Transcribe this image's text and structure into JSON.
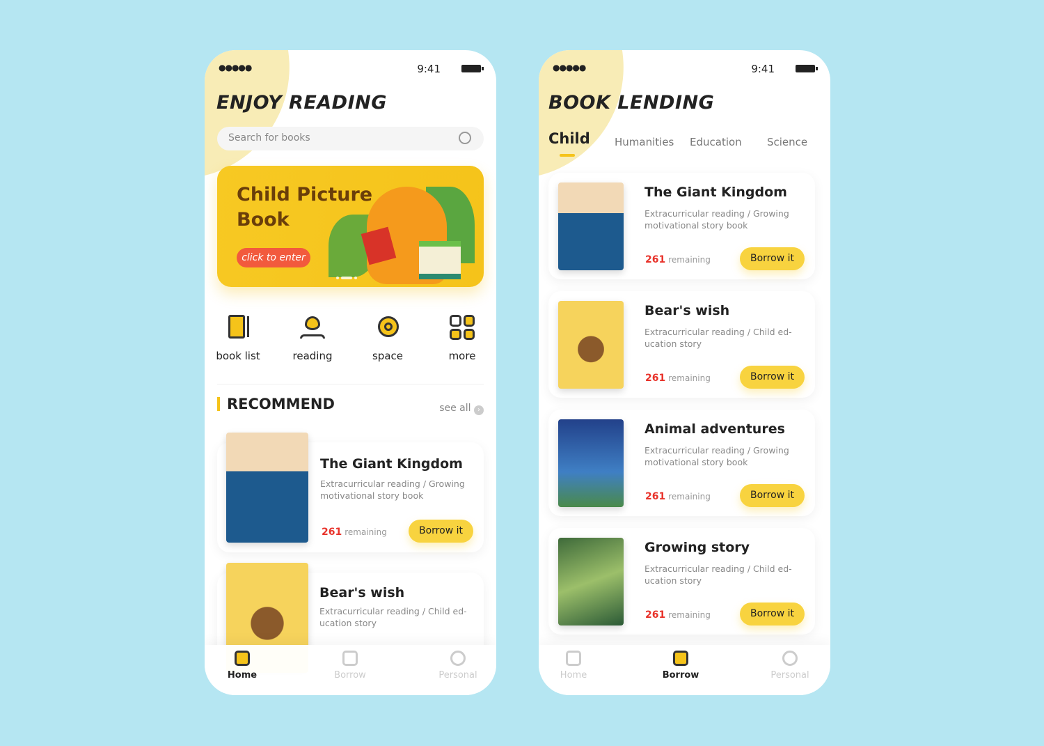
{
  "colors": {
    "background": "#b5e6f2",
    "accent": "#f8d33f",
    "remaining": "#e8322a",
    "cta": "#f25a3d"
  },
  "status": {
    "signal": "●●●●● ",
    "wifi": "wifi-icon",
    "time": "9:41"
  },
  "home": {
    "title": "ENJOY READING",
    "search_placeholder": "Search for books",
    "banner": {
      "title": "Child Picture Book",
      "button": "click to enter"
    },
    "menu": [
      {
        "label": "book list",
        "icon": "book-list-icon"
      },
      {
        "label": "reading",
        "icon": "heart-reading-icon"
      },
      {
        "label": "space",
        "icon": "planet-icon"
      },
      {
        "label": "more",
        "icon": "grid-icon"
      }
    ],
    "section_title": "RECOMMEND",
    "see_all": "see all",
    "books": [
      {
        "title": "The Giant Kingdom",
        "desc": "Extracurricular reading / Growing motivational story book",
        "count": "261",
        "remaining": "remaining",
        "button": "Borrow it"
      },
      {
        "title": "Bear's wish",
        "desc": "Extracurricular reading  / Child ed-ucation story"
      }
    ],
    "tabs": [
      "Home",
      "Borrow",
      "Personal"
    ],
    "active_tab": "Home"
  },
  "lending": {
    "title": "BOOK LENDING",
    "categories": [
      "Child",
      "Humanities",
      "Education",
      "Science"
    ],
    "active_category": "Child",
    "books": [
      {
        "title": "The Giant Kingdom",
        "desc": "Extracurricular reading / Growing motivational story book",
        "count": "261",
        "remaining": "remaining",
        "button": "Borrow it"
      },
      {
        "title": "Bear's wish",
        "desc": "Extracurricular reading  / Child ed-ucation story",
        "count": "261",
        "remaining": "remaining",
        "button": "Borrow it"
      },
      {
        "title": "Animal adventures",
        "desc": "Extracurricular reading / Growing motivational story book",
        "count": "261",
        "remaining": "remaining",
        "button": "Borrow it"
      },
      {
        "title": "Growing story",
        "desc": "Extracurricular reading  / Child ed-ucation story",
        "count": "261",
        "remaining": "remaining",
        "button": "Borrow it"
      }
    ],
    "tabs": [
      "Home",
      "Borrow",
      "Personal"
    ],
    "active_tab": "Borrow"
  }
}
